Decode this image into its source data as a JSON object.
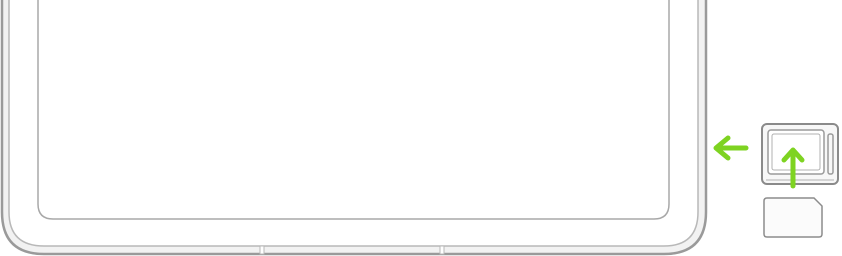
{
  "diagram": {
    "subject": "sim-tray-installation",
    "colors": {
      "background": "#ffffff",
      "device_outer_stroke": "#9a9a9a",
      "device_body_fill": "#f2f2f2",
      "device_inner_stroke": "#b8b8b8",
      "screen_stroke": "#a8a8a8",
      "screen_fill": "#ffffff",
      "tray_stroke": "#8a8a8a",
      "tray_fill": "#f7f7f7",
      "sim_card_stroke": "#8c8c8c",
      "sim_card_fill": "#fbfbfb",
      "arrow_accent": "#7ed321"
    },
    "icons": {
      "insert_tray_arrow": "arrow-left-icon",
      "insert_sim_arrow": "arrow-up-icon"
    }
  }
}
